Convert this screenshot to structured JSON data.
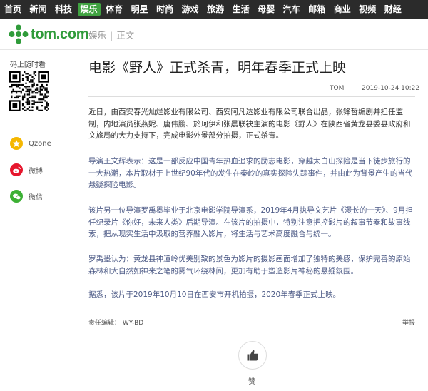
{
  "nav": [
    "首页",
    "新闻",
    "科技",
    "娱乐",
    "体育",
    "明星",
    "时尚",
    "游戏",
    "旅游",
    "生活",
    "母婴",
    "汽车",
    "邮箱",
    "商业",
    "视频",
    "财经"
  ],
  "nav_active_index": 3,
  "logo_text": "tom.com",
  "breadcrumb": [
    "娱乐",
    "正文"
  ],
  "sidebar": {
    "qr_title": "码上随时看",
    "share": [
      {
        "label": "Qzone",
        "icon": "star-icon",
        "color": "#f5b700"
      },
      {
        "label": "微博",
        "icon": "weibo-icon",
        "color": "#e6162d"
      },
      {
        "label": "微信",
        "icon": "wechat-icon",
        "color": "#3cb034"
      }
    ]
  },
  "article": {
    "title": "电影《野人》正式杀青，明年春季正式上映",
    "source": "TOM",
    "date": "2019-10-24 10:22",
    "paragraphs": [
      "近日，由西安春光灿烂影业有限公司、西安阿凡达影业有限公司联合出品，张锋哲编剧并担任监制，内地演员张燕妮、唐伟鹏、於珂伊和张晨联袂主演的电影《野人》在陕西省黄龙县委县政府和文旅局的大力支持下，完成电影外景部分拍摄，正式杀青。",
      "导演王文辉表示：这是一部反应中国青年热血追求的励志电影，穿越太白山探险是当下徒步旅行的一大热潮，本片取材于上世纪90年代的发生在秦岭的真实探险失踪事件，并由此为背景产生的当代悬疑探险电影。",
      "该片另一位导演罗禹墨毕业于北京电影学院导演系，2019年4月执导文艺片《漫长的一天》、9月担任纪录片《你好，未来人类》后期导演。在该片的拍摄中，特别注意把控影片的叙事节奏和故事线索，把从现实生活中汲取的营养融入影片，将生活与艺术高度融合与统一。",
      "罗禹墨认为：黄龙县神道岭优美别致的景色为影片的摄影画面增加了独特的美感，保护完善的原始森林和大自然如神来之笔的雾气环绕林间，更加有助于塑造影片神秘的悬疑氛围。",
      "据悉，该片于2019年10月10日在西安市开机拍摄，2020年春季正式上映。"
    ],
    "editor": "责任编辑：  WY-BD",
    "report": "举报"
  },
  "like_label": "赞",
  "colors": {
    "nav_bg": "#2b2b2b",
    "active": "#40a341",
    "logo": "#2f9b3a",
    "accent_text": "#4c5a86"
  }
}
